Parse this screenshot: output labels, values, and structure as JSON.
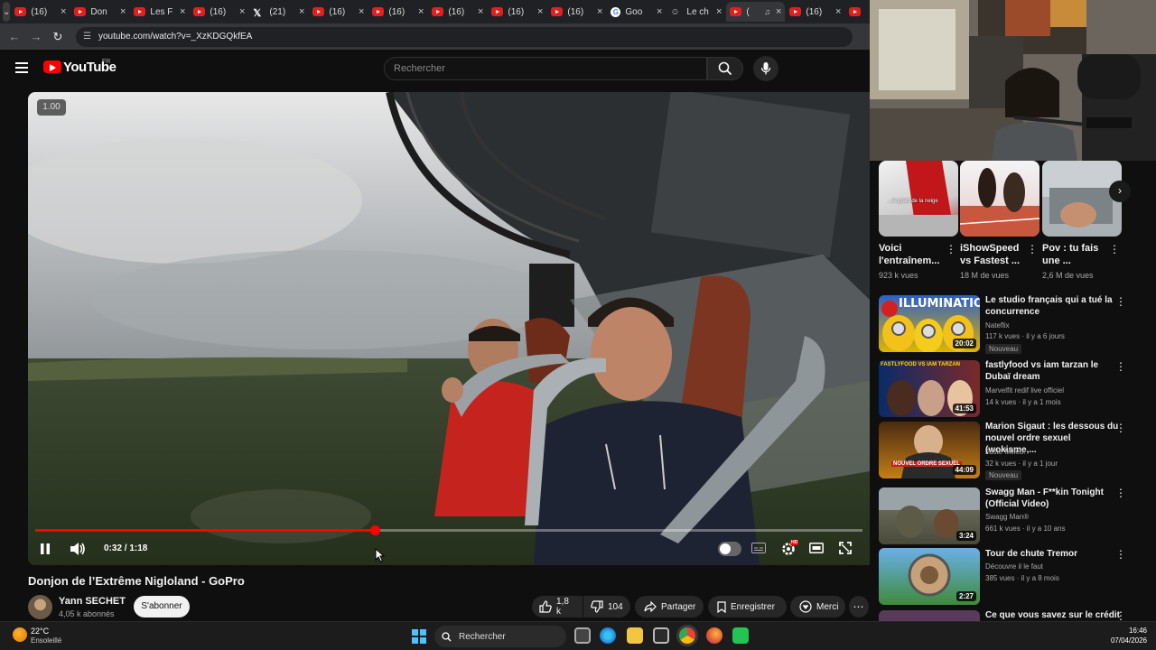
{
  "browser": {
    "tabs": [
      {
        "label": "(16)",
        "icon": "youtube",
        "active": false
      },
      {
        "label": "Don",
        "icon": "youtube",
        "active": false
      },
      {
        "label": "Les F",
        "icon": "youtube",
        "active": false
      },
      {
        "label": "(16)",
        "icon": "youtube",
        "active": false
      },
      {
        "label": "(21)",
        "icon": "x",
        "active": false
      },
      {
        "label": "(16)",
        "icon": "youtube",
        "active": false
      },
      {
        "label": "(16)",
        "icon": "youtube",
        "active": false
      },
      {
        "label": "(16)",
        "icon": "youtube",
        "active": false
      },
      {
        "label": "(16)",
        "icon": "youtube",
        "active": false
      },
      {
        "label": "(16)",
        "icon": "youtube",
        "active": false
      },
      {
        "label": "Goo",
        "icon": "google",
        "active": false
      },
      {
        "label": "Le ch",
        "icon": "person",
        "active": false
      },
      {
        "label": "(",
        "icon": "youtube",
        "active": true
      },
      {
        "label": "(16)",
        "icon": "youtube",
        "active": false
      },
      {
        "label": "",
        "icon": "youtube",
        "active": false
      }
    ],
    "url": "youtube.com/watch?v=_XzKDGQkfEA"
  },
  "header": {
    "logo_text": "YouTube",
    "country": "FR",
    "search_placeholder": "Rechercher"
  },
  "player": {
    "speed": "1.00",
    "time": "0:32 / 1:18",
    "progress_fraction": 0.41,
    "hd_badge": "HD"
  },
  "video": {
    "title": "Donjon de l’Extrême Nigloland - GoPro",
    "channel": "Yann SECHET",
    "subscribers": "4,05 k abonnés",
    "subscribe_label": "S'abonner",
    "likes": "1,8 k",
    "dislikes": "104",
    "share_label": "Partager",
    "save_label": "Enregistrer",
    "thanks_label": "Merci"
  },
  "shorts": [
    {
      "title": "Voici l'entraînem...",
      "views": "923 k vues",
      "overlay": "...le grain de la neige"
    },
    {
      "title": "iShowSpeed vs Fastest ...",
      "views": "18 M de vues"
    },
    {
      "title": "Pov : tu fais une ...",
      "views": "2,6 M de vues"
    }
  ],
  "recommended": [
    {
      "title": "Le studio français qui a tué la concurrence",
      "channel": "Nateflix",
      "meta": "117 k vues · il y a 6 jours",
      "badge": "Nouveau",
      "duration": "20:02",
      "thumb_text": "ILLUMINATION"
    },
    {
      "title": "fastlyfood  vs iam tarzan le Dubaï dream",
      "channel": "Marvelfit redif live officiel",
      "meta": "14 k vues · il y a 1 mois",
      "badge": "",
      "duration": "41:53",
      "thumb_text": "FASTLYFOOD VS IAM TARZAN"
    },
    {
      "title": "Marion Sigaut : les dessous du nouvel ordre sexuel (wokisme,...",
      "channel": "Juste Milieu.",
      "meta": "32 k vues · il y a 1 jour",
      "badge": "Nouveau",
      "duration": "44:09",
      "thumb_text": "NOUVEL ORDRE SEXUEL"
    },
    {
      "title": "Swagg Man - F**kin Tonight (Official Video)",
      "channel": "Swagg Man®",
      "meta": "661 k vues · il y a 10 ans",
      "badge": "",
      "duration": "3:24",
      "thumb_text": ""
    },
    {
      "title": "Tour de chute Tremor",
      "channel": "Découvre il le faut",
      "meta": "385 vues · il y a 8 mois",
      "badge": "",
      "duration": "2:27",
      "thumb_text": ""
    },
    {
      "title": "Ce que vous savez sur le crédit",
      "channel": "",
      "meta": "",
      "badge": "",
      "duration": "",
      "thumb_text": ""
    }
  ],
  "taskbar": {
    "temperature": "22°C",
    "condition": "Ensoleillé",
    "search_label": "Rechercher",
    "time": "16:46",
    "date": "07/04/2026"
  },
  "colors": {
    "accent": "#ff0000",
    "background": "#0f0f0f",
    "pill": "#272727",
    "windows_blue": "#4cc2ff"
  }
}
